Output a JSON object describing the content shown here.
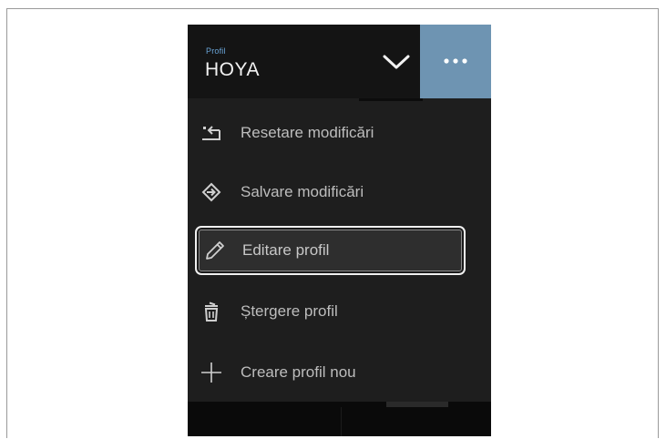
{
  "header": {
    "caption": "Profil",
    "title": "HOYA",
    "dropdown_icon": "chevron-down-icon",
    "more_icon": "more-horizontal-icon",
    "accent_color": "#6e94b2",
    "caption_color": "#6aa5d8"
  },
  "menu": {
    "items": [
      {
        "label": "Resetare modificări",
        "icon": "reset-icon",
        "selected": false
      },
      {
        "label": "Salvare modificări",
        "icon": "save-icon",
        "selected": false
      },
      {
        "label": "Editare profil",
        "icon": "pencil-icon",
        "selected": true
      },
      {
        "label": "Ștergere profil",
        "icon": "trash-icon",
        "selected": false
      },
      {
        "label": "Creare profil nou",
        "icon": "plus-icon",
        "selected": false
      }
    ]
  }
}
